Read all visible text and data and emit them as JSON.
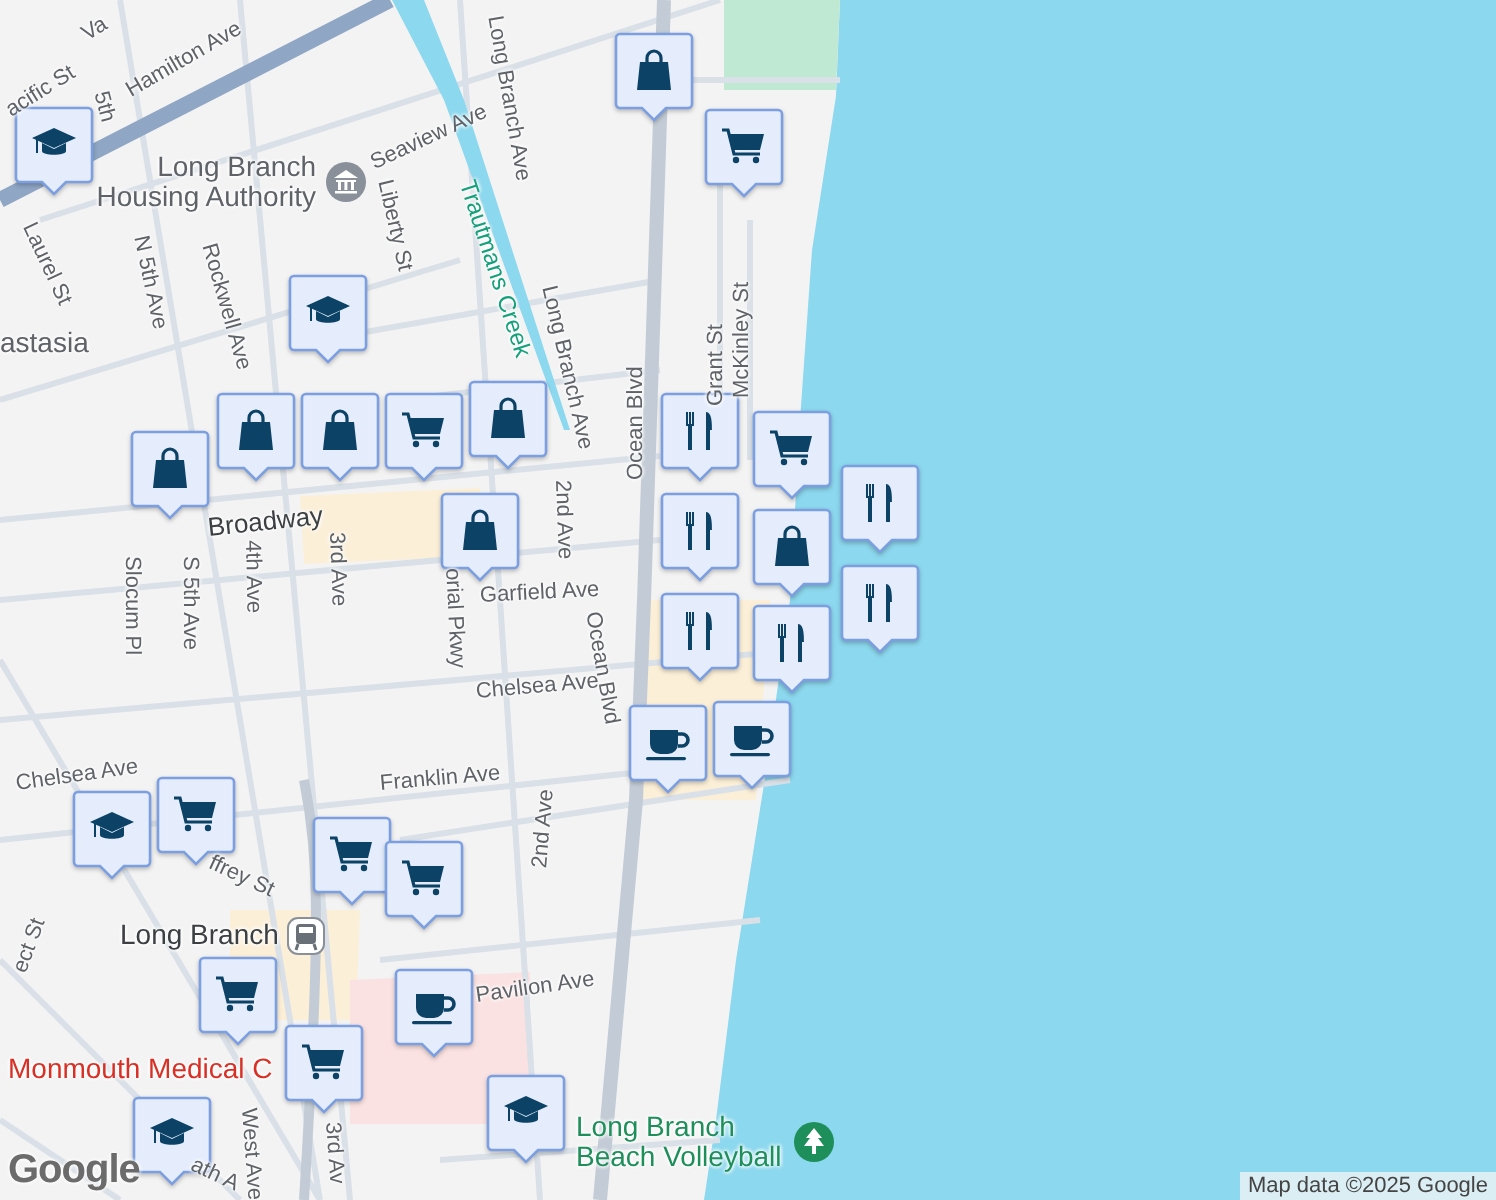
{
  "map": {
    "labels": [
      {
        "text": "acific St",
        "kind": "street"
      },
      {
        "text": "Va",
        "kind": "street"
      },
      {
        "text": "5th",
        "kind": "street"
      },
      {
        "text": "Hamilton Ave",
        "kind": "street"
      },
      {
        "text": "Seaview Ave",
        "kind": "street"
      },
      {
        "text": "Long Branch Ave",
        "kind": "street"
      },
      {
        "text": "Long Branch Housing Authority",
        "kind": "civic"
      },
      {
        "text": "Laurel St",
        "kind": "street"
      },
      {
        "text": "N 5th Ave",
        "kind": "street"
      },
      {
        "text": "Rockwell Ave",
        "kind": "street"
      },
      {
        "text": "Liberty St",
        "kind": "street"
      },
      {
        "text": "Trautmans Creek",
        "kind": "water"
      },
      {
        "text": "Long Branch Ave",
        "kind": "street"
      },
      {
        "text": "astasia",
        "kind": "place"
      },
      {
        "text": "Ocean Blvd",
        "kind": "street"
      },
      {
        "text": "Grant St",
        "kind": "street"
      },
      {
        "text": "McKinley St",
        "kind": "street"
      },
      {
        "text": "Broadway",
        "kind": "major"
      },
      {
        "text": "2nd Ave",
        "kind": "street"
      },
      {
        "text": "Slocum Pl",
        "kind": "street"
      },
      {
        "text": "S 5th Ave",
        "kind": "street"
      },
      {
        "text": "4th Ave",
        "kind": "street"
      },
      {
        "text": "3rd Ave",
        "kind": "street"
      },
      {
        "text": "orial Pkwy",
        "kind": "street"
      },
      {
        "text": "Garfield Ave",
        "kind": "street"
      },
      {
        "text": "Ocean Blvd",
        "kind": "street"
      },
      {
        "text": "Chelsea Ave",
        "kind": "street"
      },
      {
        "text": "Chelsea Ave",
        "kind": "street"
      },
      {
        "text": "Franklin Ave",
        "kind": "street"
      },
      {
        "text": "2nd Ave",
        "kind": "street"
      },
      {
        "text": "ffrey St",
        "kind": "street"
      },
      {
        "text": "ect St",
        "kind": "street"
      },
      {
        "text": "Long Branch",
        "kind": "transit"
      },
      {
        "text": "Pavilion Ave",
        "kind": "street"
      },
      {
        "text": "Monmouth Medical C",
        "kind": "hospital"
      },
      {
        "text": "West Ave",
        "kind": "street"
      },
      {
        "text": "3rd Av",
        "kind": "street"
      },
      {
        "text": "ath A",
        "kind": "street"
      },
      {
        "text": "Long Branch Beach Volleyball",
        "kind": "park"
      }
    ],
    "markers": [
      {
        "kind": "shopping"
      },
      {
        "kind": "grocery"
      },
      {
        "kind": "school"
      },
      {
        "kind": "school"
      },
      {
        "kind": "restaurant"
      },
      {
        "kind": "shopping"
      },
      {
        "kind": "shopping"
      },
      {
        "kind": "grocery"
      },
      {
        "kind": "shopping"
      },
      {
        "kind": "shopping"
      },
      {
        "kind": "grocery"
      },
      {
        "kind": "shopping"
      },
      {
        "kind": "restaurant"
      },
      {
        "kind": "restaurant"
      },
      {
        "kind": "shopping"
      },
      {
        "kind": "restaurant"
      },
      {
        "kind": "restaurant"
      },
      {
        "kind": "restaurant"
      },
      {
        "kind": "cafe"
      },
      {
        "kind": "cafe"
      },
      {
        "kind": "school"
      },
      {
        "kind": "grocery"
      },
      {
        "kind": "grocery"
      },
      {
        "kind": "grocery"
      },
      {
        "kind": "cafe"
      },
      {
        "kind": "grocery"
      },
      {
        "kind": "grocery"
      },
      {
        "kind": "school"
      },
      {
        "kind": "school"
      }
    ],
    "logo": "Google",
    "attribution": "Map data ©2025 Google"
  }
}
